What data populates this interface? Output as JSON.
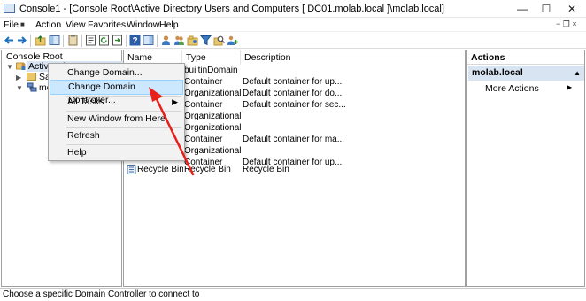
{
  "window": {
    "title": "Console1 - [Console Root\\Active Directory Users and Computers [ DC01.molab.local ]\\molab.local]",
    "minimize": "—",
    "maximize": "☐",
    "close": "✕",
    "restore": "− ❐ ×"
  },
  "menu": [
    "File",
    "Action",
    "View",
    "Favorites",
    "Window",
    "Help"
  ],
  "tree": {
    "root": "Console Root",
    "node": "Active Directory Users and Computers [ DC01.molab.local ]",
    "node_visible": "Active Directory Users and C",
    "child1": "Saved Queries",
    "child1_visible": "Sav",
    "child2": "molab.local",
    "child2_visible": "mo"
  },
  "list": {
    "headers": [
      "Name",
      "Type",
      "Description"
    ],
    "rows": [
      {
        "name": "",
        "type": "builtinDomain",
        "desc": ""
      },
      {
        "name": "",
        "type": "Container",
        "desc": "Default container for up..."
      },
      {
        "name": "",
        "type": "Organizational...",
        "desc": "Default container for do..."
      },
      {
        "name": "",
        "type": "Container",
        "desc": "Default container for sec..."
      },
      {
        "name": "",
        "type": "Organizational...",
        "desc": ""
      },
      {
        "name": "",
        "type": "Organizational...",
        "desc": ""
      },
      {
        "name": "",
        "type": "Container",
        "desc": "Default container for ma..."
      },
      {
        "name": "",
        "type": "Organizational...",
        "desc": ""
      },
      {
        "name": "",
        "type": "Container",
        "desc": "Default container for up..."
      },
      {
        "name": "Recycle Bin",
        "type": "Recycle Bin",
        "desc": "Recycle Bin"
      }
    ]
  },
  "actions": {
    "header": "Actions",
    "domain": "molab.local",
    "more": "More Actions"
  },
  "context_menu": {
    "items": [
      "Change Domain...",
      "Change Domain Controller...",
      "All Tasks",
      "New Window from Here",
      "Refresh",
      "Help"
    ]
  },
  "status": "Choose a specific Domain Controller to connect to",
  "colors": {
    "highlight": "#cce8ff",
    "arrow": "#e8201c",
    "actions_domain_bg": "#d9e4f2"
  }
}
